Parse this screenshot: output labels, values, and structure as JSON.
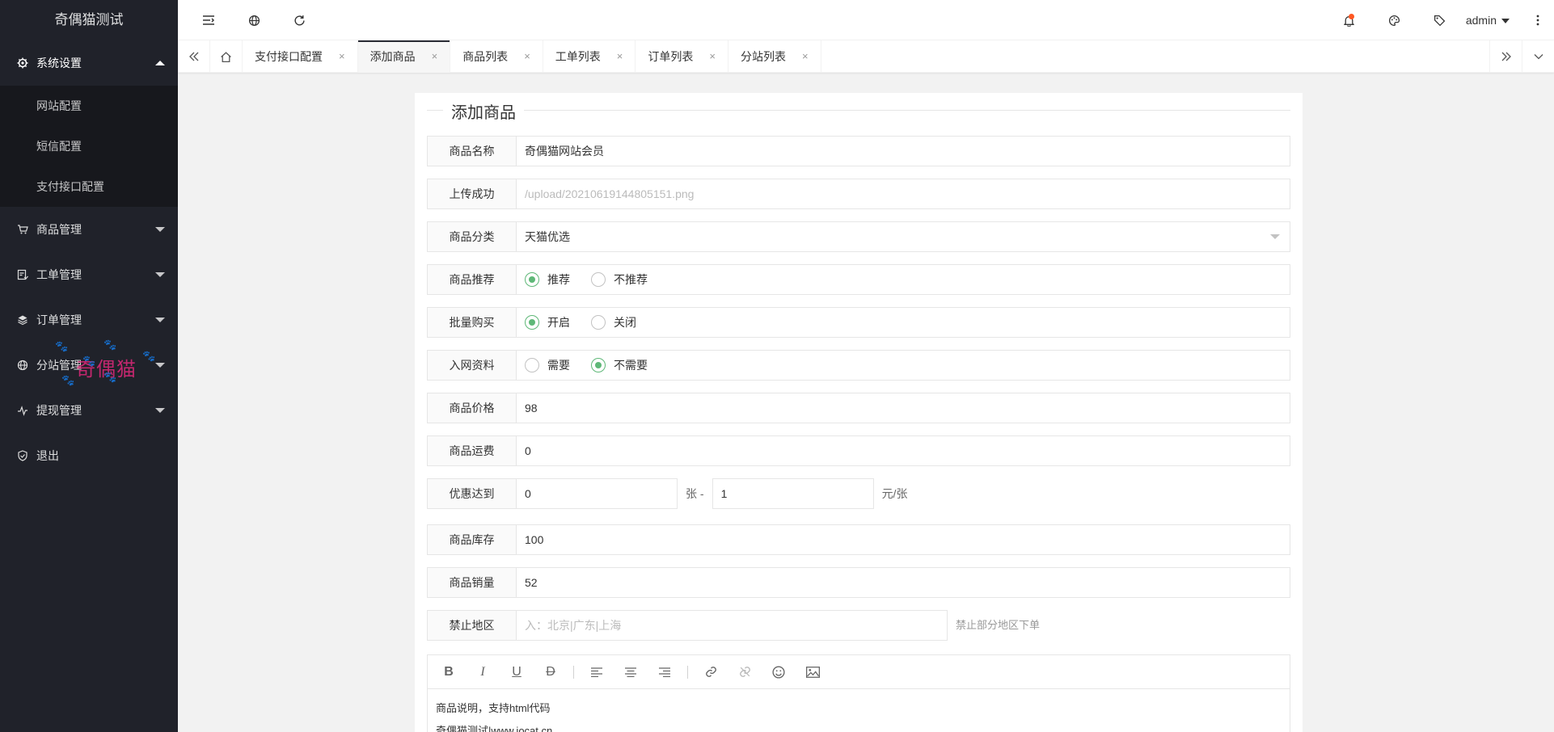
{
  "app": {
    "title": "奇偶猫测试"
  },
  "sidebar": {
    "groups": [
      {
        "label": "系统设置",
        "icon": "gear-icon",
        "open": true,
        "items": [
          "网站配置",
          "短信配置",
          "支付接口配置"
        ]
      },
      {
        "label": "商品管理",
        "icon": "cart-icon"
      },
      {
        "label": "工单管理",
        "icon": "ticket-icon"
      },
      {
        "label": "订单管理",
        "icon": "layers-icon"
      },
      {
        "label": "分站管理",
        "icon": "globe-icon"
      },
      {
        "label": "提现管理",
        "icon": "pulse-icon"
      },
      {
        "label": "退出",
        "icon": "shield-icon"
      }
    ],
    "watermark_text": "奇偶猫"
  },
  "header": {
    "username": "admin",
    "notification_dot_color": "#ff5722"
  },
  "tabs": {
    "items": [
      {
        "label": "支付接口配置",
        "active": false
      },
      {
        "label": "添加商品",
        "active": true
      },
      {
        "label": "商品列表",
        "active": false
      },
      {
        "label": "工单列表",
        "active": false
      },
      {
        "label": "订单列表",
        "active": false
      },
      {
        "label": "分站列表",
        "active": false
      }
    ],
    "close_glyph": "×"
  },
  "form": {
    "legend": "添加商品",
    "name": {
      "label": "商品名称",
      "value": "奇偶猫网站会员"
    },
    "upload": {
      "label": "上传成功",
      "value": "/upload/20210619144805151.png"
    },
    "category": {
      "label": "商品分类",
      "value": "天猫优选"
    },
    "recommend": {
      "label": "商品推荐",
      "options": [
        "推荐",
        "不推荐"
      ],
      "selected": "推荐"
    },
    "bulk": {
      "label": "批量购买",
      "options": [
        "开启",
        "关闭"
      ],
      "selected": "开启"
    },
    "network": {
      "label": "入网资料",
      "options": [
        "需要",
        "不需要"
      ],
      "selected": "不需要"
    },
    "price": {
      "label": "商品价格",
      "value": "98"
    },
    "shipping": {
      "label": "商品运费",
      "value": "0"
    },
    "discount": {
      "label": "优惠达到",
      "qty": "0",
      "qty_unit": "张 -",
      "price": "1",
      "price_unit": "元/张"
    },
    "stock": {
      "label": "商品库存",
      "value": "100"
    },
    "sales": {
      "label": "商品销量",
      "value": "52"
    },
    "region": {
      "label": "禁止地区",
      "placeholder": "入：北京|广东|上海",
      "hint": "禁止部分地区下单"
    },
    "editor": {
      "lines": [
        "商品说明，支持html代码",
        "奇偶猫测试|www.iocat.cn"
      ]
    }
  },
  "colors": {
    "accent": "#5fb878",
    "sidebar_bg": "#20222a",
    "subnav_bg": "#17181d"
  }
}
